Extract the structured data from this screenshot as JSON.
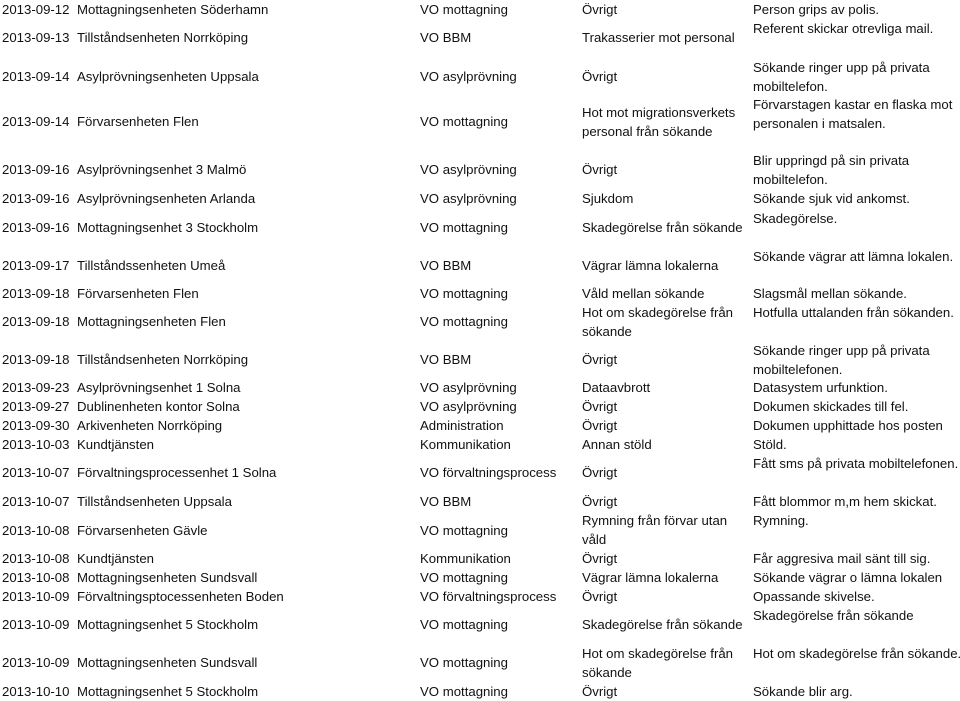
{
  "document": {
    "rows": [
      {
        "date": "2013-09-12",
        "unit": "Mottagningsenheten Söderhamn",
        "dept": "VO mottagning",
        "category": [
          "Övrigt"
        ],
        "description": [
          "Person grips av polis."
        ]
      },
      {
        "date": "2013-09-13",
        "unit": "Tillståndsenheten Norrköping",
        "dept": "VO BBM",
        "category": [
          "Trakasserier mot personal"
        ],
        "description": [
          "Referent skickar otrevliga mail."
        ]
      },
      {
        "date": "2013-09-14",
        "unit": "Asylprövningsenheten Uppsala",
        "dept": "VO asylprövning",
        "category": [
          "Övrigt"
        ],
        "description": [
          "Sökande ringer upp på privata",
          "mobiltelefon."
        ]
      },
      {
        "date": "2013-09-14",
        "unit": "Förvarsenheten Flen",
        "dept": "VO mottagning",
        "category": [
          "Hot mot migrationsverkets",
          "personal från sökande"
        ],
        "description": [
          "Förvarstagen kastar en flaska mot",
          "personalen i matsalen."
        ]
      },
      {
        "date": "2013-09-16",
        "unit": "Asylprövningsenhet 3 Malmö",
        "dept": "VO asylprövning",
        "category": [
          "Övrigt"
        ],
        "description": [
          "Blir uppringd på sin privata",
          "mobiltelefon."
        ]
      },
      {
        "date": "2013-09-16",
        "unit": "Asylprövningsenheten Arlanda",
        "dept": "VO asylprövning",
        "category": [
          "Sjukdom"
        ],
        "description": [
          "Sökande sjuk vid ankomst."
        ]
      },
      {
        "date": "2013-09-16",
        "unit": "Mottagningsenhet 3  Stockholm",
        "dept": "VO mottagning",
        "category": [
          "Skadegörelse från sökande"
        ],
        "description": [
          "Skadegörelse."
        ]
      },
      {
        "date": "2013-09-17",
        "unit": "Tillståndssenheten Umeå",
        "dept": "VO BBM",
        "category": [
          "Vägrar lämna lokalerna"
        ],
        "description": [
          "Sökande vägrar att lämna lokalen."
        ]
      },
      {
        "date": "2013-09-18",
        "unit": "Förvarsenheten Flen",
        "dept": "VO mottagning",
        "category": [
          "Våld mellan sökande"
        ],
        "description": [
          "Slagsmål mellan sökande."
        ]
      },
      {
        "date": "2013-09-18",
        "unit": "Mottagningsenheten Flen",
        "dept": "VO mottagning",
        "category": [
          "Hot om skadegörelse från",
          "sökande"
        ],
        "description": [
          "Hotfulla uttalanden från sökanden."
        ]
      },
      {
        "date": "2013-09-18",
        "unit": "Tillståndsenheten Norrköping",
        "dept": "VO BBM",
        "category": [
          "Övrigt"
        ],
        "description": [
          "Sökande ringer upp på privata",
          "mobiltelefonen."
        ]
      },
      {
        "date": "2013-09-23",
        "unit": "Asylprövningsenhet 1 Solna",
        "dept": "VO asylprövning",
        "category": [
          "Dataavbrott"
        ],
        "description": [
          "Datasystem urfunktion."
        ]
      },
      {
        "date": "2013-09-27",
        "unit": "Dublinenheten kontor Solna",
        "dept": "VO asylprövning",
        "category": [
          "Övrigt"
        ],
        "description": [
          "Dokumen skickades till fel."
        ]
      },
      {
        "date": "2013-09-30",
        "unit": "Arkivenheten Norrköping",
        "dept": "Administration",
        "category": [
          "Övrigt"
        ],
        "description": [
          "Dokumen upphittade hos posten"
        ]
      },
      {
        "date": "2013-10-03",
        "unit": "Kundtjänsten",
        "dept": "Kommunikation",
        "category": [
          "Annan stöld"
        ],
        "description": [
          "Stöld."
        ]
      },
      {
        "date": "2013-10-07",
        "unit": "Förvaltningsprocessenhet 1 Solna",
        "dept": "VO förvaltningsprocess",
        "category": [
          "Övrigt"
        ],
        "description": [
          "Fått sms på privata mobiltelefonen."
        ]
      },
      {
        "date": "2013-10-07",
        "unit": "Tillståndsenheten Uppsala",
        "dept": "VO BBM",
        "category": [
          "Övrigt"
        ],
        "description": [
          "Fått blommor m,m hem skickat."
        ]
      },
      {
        "date": "2013-10-08",
        "unit": "Förvarsenheten Gävle",
        "dept": "VO mottagning",
        "category": [
          "Rymning från förvar utan",
          "våld"
        ],
        "description": [
          "Rymning."
        ]
      },
      {
        "date": "2013-10-08",
        "unit": "Kundtjänsten",
        "dept": "Kommunikation",
        "category": [
          "Övrigt"
        ],
        "description": [
          "Får aggresiva mail sänt till sig."
        ]
      },
      {
        "date": "2013-10-08",
        "unit": "Mottagningsenheten Sundsvall",
        "dept": "VO mottagning",
        "category": [
          "Vägrar lämna lokalerna"
        ],
        "description": [
          "Sökande vägrar o lämna lokalen"
        ]
      },
      {
        "date": "2013-10-09",
        "unit": "Förvaltningsptocessenheten Boden",
        "dept": "VO förvaltningsprocess",
        "category": [
          "Övrigt"
        ],
        "description": [
          "Opassande skivelse."
        ]
      },
      {
        "date": "2013-10-09",
        "unit": "Mottagningsenhet 5  Stockholm",
        "dept": "VO mottagning",
        "category": [
          "Skadegörelse från sökande"
        ],
        "description": [
          "Skadegörelse från sökande"
        ]
      },
      {
        "date": "2013-10-09",
        "unit": "Mottagningsenheten Sundsvall",
        "dept": "VO mottagning",
        "category": [
          "Hot om skadegörelse från",
          "sökande"
        ],
        "description": [
          "Hot om skadegörelse från sökande."
        ]
      },
      {
        "date": "2013-10-10",
        "unit": "Mottagningsenhet 5  Stockholm",
        "dept": "VO mottagning",
        "category": [
          "Övrigt"
        ],
        "description": [
          "Sökande blir arg."
        ]
      }
    ]
  }
}
